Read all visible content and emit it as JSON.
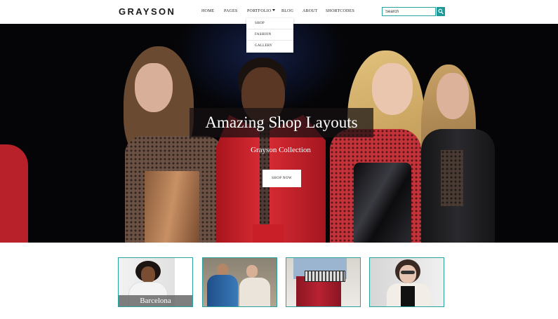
{
  "header": {
    "logo": "GRAYSON",
    "nav": [
      {
        "label": "HOME"
      },
      {
        "label": "PAGES"
      },
      {
        "label": "PORTFOLIO"
      },
      {
        "label": "BLOG"
      },
      {
        "label": "ABOUT"
      },
      {
        "label": "SHORTCODES"
      }
    ],
    "search": {
      "value": "Search",
      "button_icon": "search-icon"
    }
  },
  "dropdown": {
    "items": [
      {
        "label": "SHOP"
      },
      {
        "label": "FASHION"
      },
      {
        "label": "GALLERY"
      }
    ]
  },
  "hero": {
    "title": "Amazing Shop Layouts",
    "subtitle": "Grayson Collection",
    "button": "SHOP NOW"
  },
  "thumbnails": [
    {
      "caption": "Barcelona"
    },
    {
      "caption": ""
    },
    {
      "caption": ""
    },
    {
      "caption": ""
    }
  ],
  "colors": {
    "accent": "#1f9a98",
    "text": "#222222",
    "hero_bg": "#050507"
  }
}
